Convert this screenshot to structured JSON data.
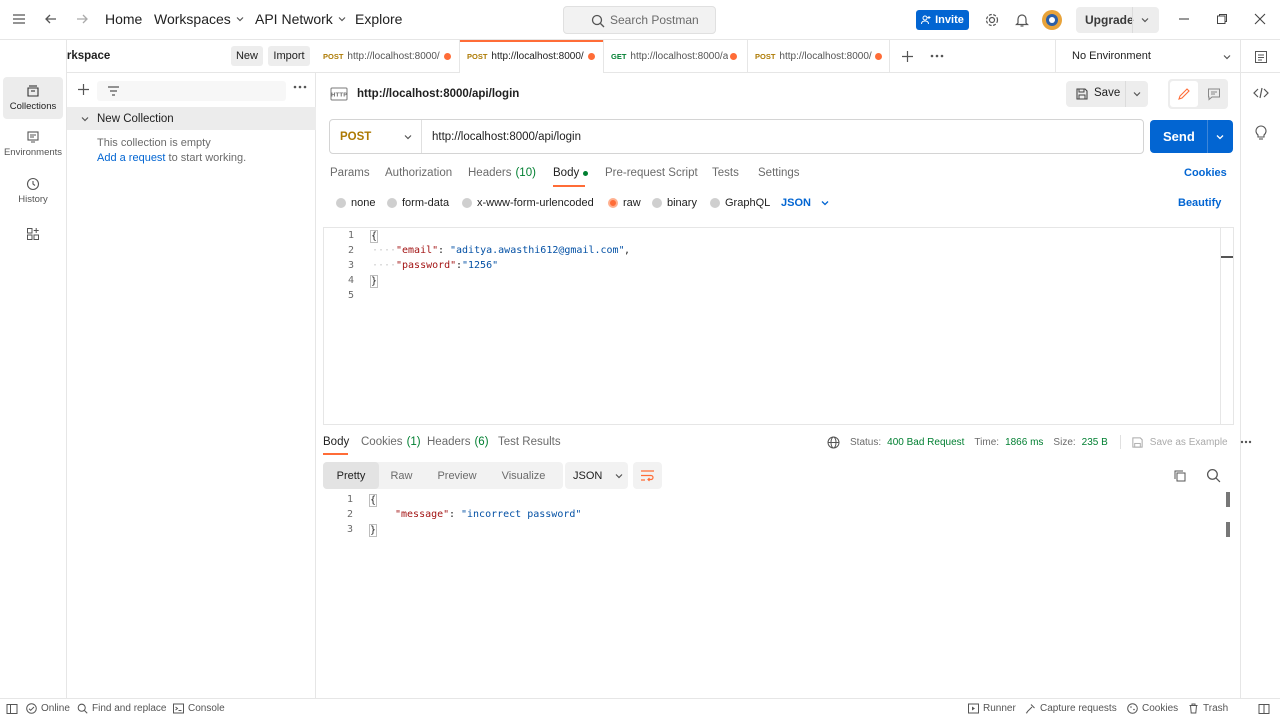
{
  "topbar": {
    "home": "Home",
    "workspaces": "Workspaces",
    "api_network": "API Network",
    "explore": "Explore",
    "search_placeholder": "Search Postman",
    "invite": "Invite",
    "upgrade": "Upgrade"
  },
  "workspace": {
    "name": "My Workspace",
    "new_label": "New",
    "import_label": "Import"
  },
  "rail": {
    "collections": "Collections",
    "environments": "Environments",
    "history": "History"
  },
  "sidebar": {
    "collection_name": "New Collection",
    "empty_text": "This collection is empty",
    "add_request_link": "Add a request",
    "add_request_rest": " to start working."
  },
  "tabs": [
    {
      "method": "POST",
      "url": "http://localhost:8000/"
    },
    {
      "method": "POST",
      "url": "http://localhost:8000/"
    },
    {
      "method": "GET",
      "url": "http://localhost:8000/a"
    },
    {
      "method": "POST",
      "url": "http://localhost:8000/"
    }
  ],
  "environment": "No Environment",
  "request": {
    "title": "http://localhost:8000/api/login",
    "save_label": "Save",
    "method": "POST",
    "url": "http://localhost:8000/api/login",
    "send_label": "Send"
  },
  "request_tabs": {
    "params": "Params",
    "authorization": "Authorization",
    "headers": "Headers",
    "headers_count": "(10)",
    "body": "Body",
    "pre_request": "Pre-request Script",
    "tests": "Tests",
    "settings": "Settings",
    "cookies": "Cookies"
  },
  "body_types": {
    "none": "none",
    "form_data": "form-data",
    "urlencoded": "x-www-form-urlencoded",
    "raw": "raw",
    "binary": "binary",
    "graphql": "GraphQL",
    "format": "JSON",
    "beautify": "Beautify"
  },
  "request_body": {
    "line_numbers": [
      "1",
      "2",
      "3",
      "4",
      "5"
    ],
    "open_brace": "{",
    "email_key": "\"email\"",
    "email_value": "\"aditya.awasthi612@gmail.com\"",
    "password_key": "\"password\"",
    "password_value": "\"1256\"",
    "close_brace": "}"
  },
  "response_tabs": {
    "body": "Body",
    "cookies": "Cookies",
    "cookies_count": "(1)",
    "headers": "Headers",
    "headers_count": "(6)",
    "test_results": "Test Results"
  },
  "response_status": {
    "status_label": "Status:",
    "status_value": "400 Bad Request",
    "time_label": "Time:",
    "time_value": "1866 ms",
    "size_label": "Size:",
    "size_value": "235 B",
    "save_example": "Save as Example"
  },
  "response_view": {
    "pretty": "Pretty",
    "raw": "Raw",
    "preview": "Preview",
    "visualize": "Visualize",
    "format": "JSON"
  },
  "response_body": {
    "line_numbers": [
      "1",
      "2",
      "3"
    ],
    "open_brace": "{",
    "message_key": "\"message\"",
    "message_value": "\"incorrect password\"",
    "close_brace": "}"
  },
  "statusbar": {
    "online": "Online",
    "find_replace": "Find and replace",
    "console": "Console",
    "runner": "Runner",
    "capture": "Capture requests",
    "cookies": "Cookies",
    "trash": "Trash"
  },
  "colors": {
    "accent_orange": "#ff6c37",
    "primary_blue": "#0265d2",
    "post_method": "#ad7a03",
    "get_method": "#007f31",
    "status_green": "#007f31"
  }
}
